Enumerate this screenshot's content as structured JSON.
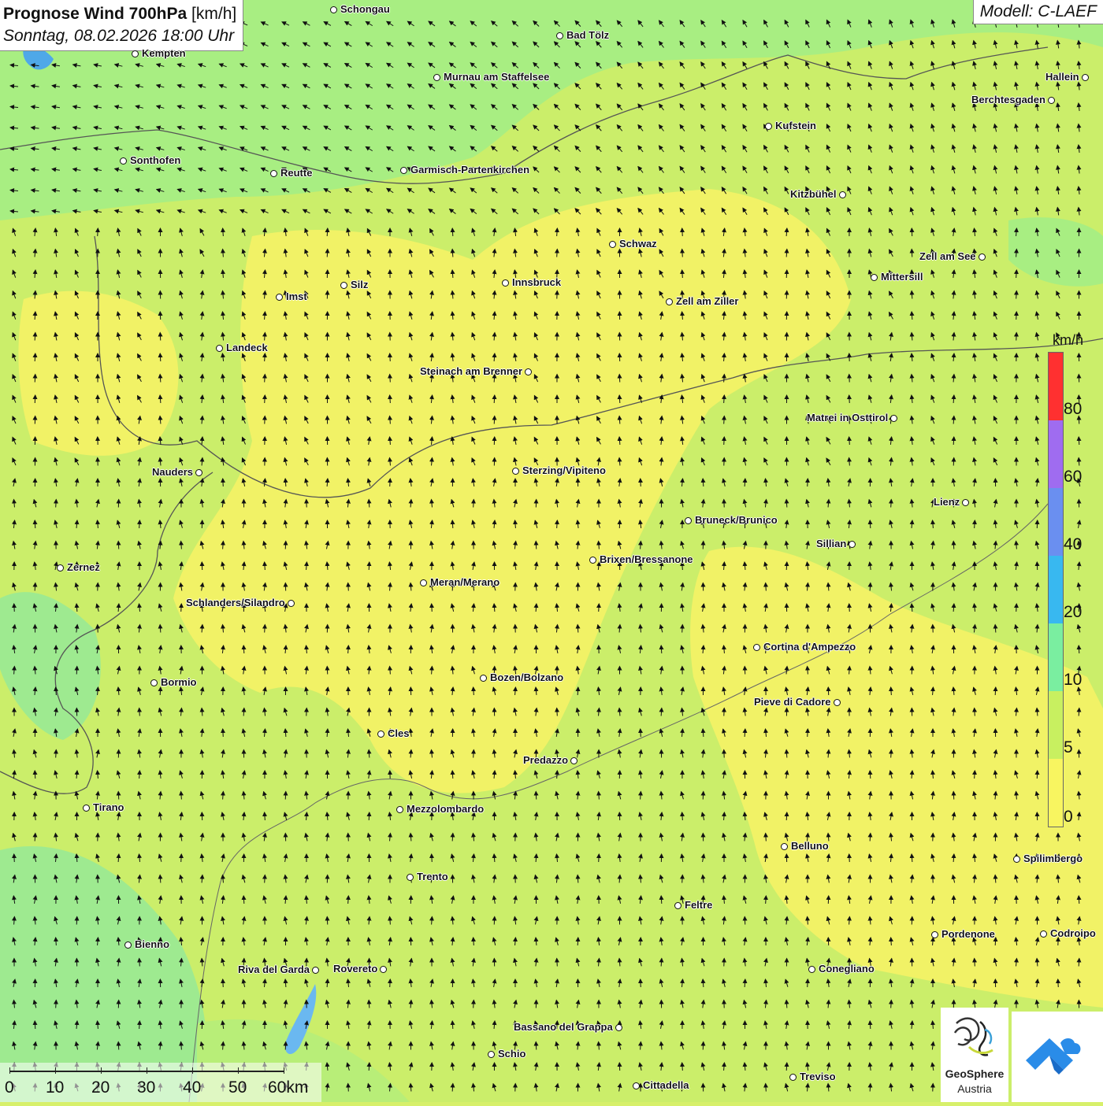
{
  "title": {
    "main": "Prognose Wind 700hPa",
    "unit": "[km/h]",
    "date": "Sonntag, 08.02.2026 18:00 Uhr"
  },
  "model": "Modell: C-LAEF",
  "legend": {
    "unit": "km/h",
    "labels": [
      "80",
      "60",
      "40",
      "20",
      "10",
      "5",
      "0"
    ],
    "colors": [
      "#ff3030",
      "#9f6cf0",
      "#6a8ff0",
      "#38b8f0",
      "#7aeea0",
      "#c8f060",
      "#f8f560",
      "#fffbb8"
    ]
  },
  "scalebar": {
    "labels": [
      "0",
      "10",
      "20",
      "30",
      "40",
      "50",
      "60km"
    ]
  },
  "logos": {
    "geosphere_line1": "GeoSphere",
    "geosphere_line2": "Austria"
  },
  "wind": {
    "direction": "predominantly from the south (arrows pointing north)"
  },
  "cities": [
    {
      "name": "Schongau"
    },
    {
      "name": "Bad Tölz"
    },
    {
      "name": "Kempten"
    },
    {
      "name": "Murnau am Staffelsee"
    },
    {
      "name": "Hallein"
    },
    {
      "name": "Berchtesgaden"
    },
    {
      "name": "Kufstein"
    },
    {
      "name": "Sonthofen"
    },
    {
      "name": "Reutte"
    },
    {
      "name": "Garmisch-Partenkirchen"
    },
    {
      "name": "Kitzbühel"
    },
    {
      "name": "Schwaz"
    },
    {
      "name": "Zell am See"
    },
    {
      "name": "Mittersill"
    },
    {
      "name": "Innsbruck"
    },
    {
      "name": "Imst"
    },
    {
      "name": "Silz"
    },
    {
      "name": "Zell am Ziller"
    },
    {
      "name": "Landeck"
    },
    {
      "name": "Steinach am Brenner"
    },
    {
      "name": "Matrei in Osttirol"
    },
    {
      "name": "Nauders"
    },
    {
      "name": "Sterzing/Vipiteno"
    },
    {
      "name": "Lienz"
    },
    {
      "name": "Bruneck/Brunico"
    },
    {
      "name": "Sillian"
    },
    {
      "name": "Brixen/Bressanone"
    },
    {
      "name": "Zernez"
    },
    {
      "name": "Meran/Merano"
    },
    {
      "name": "Schlanders/Silandro"
    },
    {
      "name": "Cortina d'Ampezzo"
    },
    {
      "name": "Bozen/Bolzano"
    },
    {
      "name": "Bormio"
    },
    {
      "name": "Pieve di Cadore"
    },
    {
      "name": "Cles"
    },
    {
      "name": "Predazzo"
    },
    {
      "name": "Tirano"
    },
    {
      "name": "Mezzolombardo"
    },
    {
      "name": "Belluno"
    },
    {
      "name": "Spilimbergo"
    },
    {
      "name": "Trento"
    },
    {
      "name": "Feltre"
    },
    {
      "name": "Pordenone"
    },
    {
      "name": "Codroipo"
    },
    {
      "name": "Bienno"
    },
    {
      "name": "Riva del Garda"
    },
    {
      "name": "Rovereto"
    },
    {
      "name": "Conegliano"
    },
    {
      "name": "Bassano del Grappa"
    },
    {
      "name": "Schio"
    },
    {
      "name": "Treviso"
    },
    {
      "name": "Cittadella"
    }
  ]
}
